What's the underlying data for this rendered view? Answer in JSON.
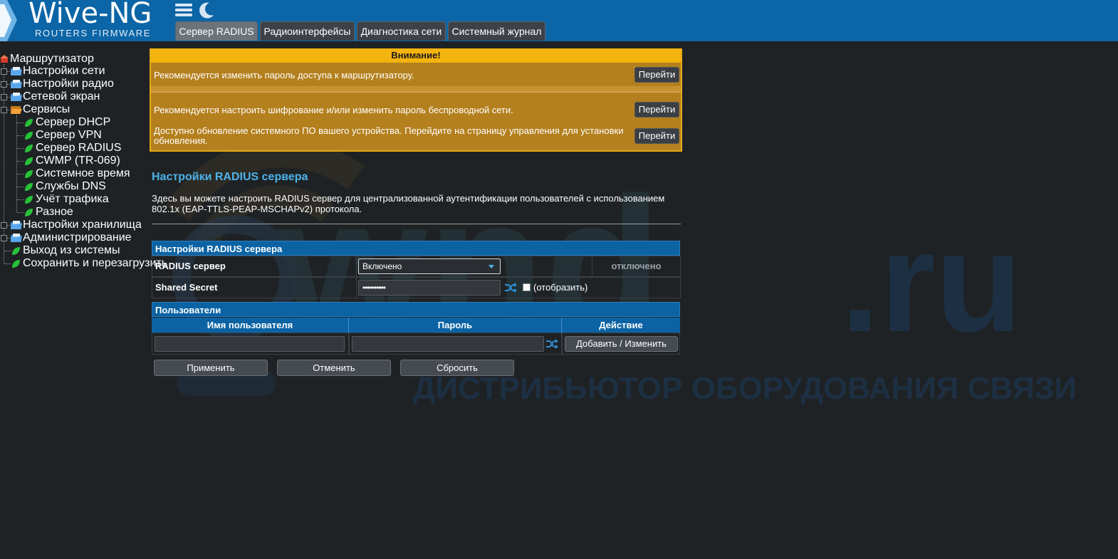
{
  "header": {
    "logo_title": "Wive-NG",
    "logo_subtitle": "ROUTERS FIRMWARE",
    "tabs": [
      {
        "label": "Сервер RADIUS",
        "active": true
      },
      {
        "label": "Радиоинтерфейсы",
        "active": false
      },
      {
        "label": "Диагностика сети",
        "active": false
      },
      {
        "label": "Системный журнал",
        "active": false
      }
    ]
  },
  "tree": {
    "root": "Маршрутизатор",
    "items": [
      {
        "label": "Настройки сети",
        "type": "folder"
      },
      {
        "label": "Настройки радио",
        "type": "folder"
      },
      {
        "label": "Сетевой экран",
        "type": "folder"
      },
      {
        "label": "Сервисы",
        "type": "folder-open"
      },
      {
        "label": "Сервер DHCP",
        "type": "leaf"
      },
      {
        "label": "Сервер VPN",
        "type": "leaf"
      },
      {
        "label": "Сервер RADIUS",
        "type": "leaf"
      },
      {
        "label": "CWMP (TR-069)",
        "type": "leaf"
      },
      {
        "label": "Системное время",
        "type": "leaf"
      },
      {
        "label": "Службы DNS",
        "type": "leaf"
      },
      {
        "label": "Учёт трафика",
        "type": "leaf"
      },
      {
        "label": "Разное",
        "type": "leaf"
      },
      {
        "label": "Настройки хранилища",
        "type": "folder"
      },
      {
        "label": "Администрирование",
        "type": "folder"
      },
      {
        "label": "Выход из системы",
        "type": "leaf"
      },
      {
        "label": "Сохранить и перезагрузить",
        "type": "leaf"
      }
    ]
  },
  "warning": {
    "title": "Внимание!",
    "messages": [
      "Рекомендуется изменить пароль доступа к маршрутизатору.",
      "Рекомендуется настроить шифрование и/или изменить пароль беспроводной сети.",
      "Доступно обновление системного ПО вашего устройства. Перейдите на страницу управления для установки обновления."
    ],
    "button_label": "Перейти"
  },
  "page": {
    "title": "Настройки RADIUS сервера",
    "description": "Здесь вы можете настроить RADIUS сервер для централизованной аутентификации пользователей с использованием 802.1x (EAP-TTLS-PEAP-MSCHAPv2) протокола."
  },
  "radius": {
    "section_title": "Настройки RADIUS сервера",
    "server_label": "RADIUS сервер",
    "server_value": "Включено",
    "server_status": "отключено",
    "secret_label": "Shared Secret",
    "secret_value": "••••••••••",
    "show_label": "(отобразить)",
    "show_checked": false
  },
  "users": {
    "section_title": "Пользователи",
    "col_username": "Имя пользователя",
    "col_password": "Пароль",
    "col_action": "Действие",
    "username_value": "",
    "password_value": "",
    "add_button": "Добавить / Изменить"
  },
  "actions": {
    "apply": "Применить",
    "cancel": "Отменить",
    "reset": "Сбросить"
  },
  "watermark": {
    "brand": "wnd.ru",
    "tagline": "ДИСТРИБЬЮТОР ОБОРУДОВАНИЯ СВЯЗИ"
  },
  "colors": {
    "header_bg": "#0b65a6",
    "accent_blue": "#4db3ea",
    "warning_yellow": "#f4b30e",
    "page_bg": "#1f2224"
  }
}
